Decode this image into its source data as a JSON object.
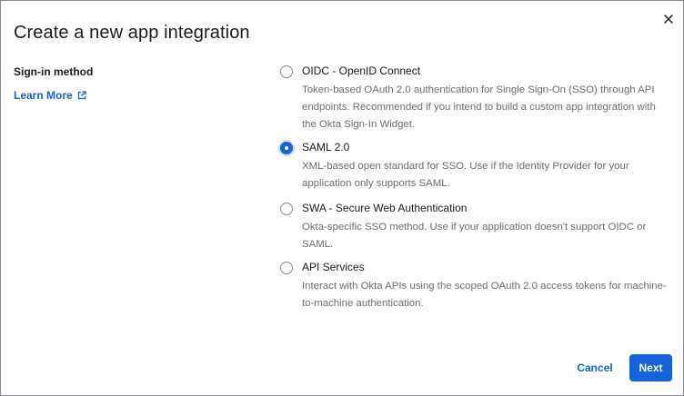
{
  "dialog": {
    "title": "Create a new app integration",
    "close_icon": "close-icon"
  },
  "left": {
    "label": "Sign-in method",
    "learn_more": "Learn More",
    "learn_more_icon": "external-link-icon"
  },
  "options": [
    {
      "title": "OIDC - OpenID Connect",
      "description": "Token-based OAuth 2.0 authentication for Single Sign-On (SSO) through API endpoints. Recommended if you intend to build a custom app integration with the Okta Sign-In Widget.",
      "selected": false
    },
    {
      "title": "SAML 2.0",
      "description": "XML-based open standard for SSO. Use if the Identity Provider for your application only supports SAML.",
      "selected": true
    },
    {
      "title": "SWA - Secure Web Authentication",
      "description": "Okta-specific SSO method. Use if your application doesn't support OIDC or SAML.",
      "selected": false
    },
    {
      "title": "API Services",
      "description": "Interact with Okta APIs using the scoped OAuth 2.0 access tokens for machine-to-machine authentication.",
      "selected": false
    }
  ],
  "footer": {
    "cancel_label": "Cancel",
    "next_label": "Next"
  },
  "colors": {
    "accent": "#1662dd",
    "text": "#1d1d21",
    "muted": "#6e6e78",
    "border": "#8c8c96"
  }
}
